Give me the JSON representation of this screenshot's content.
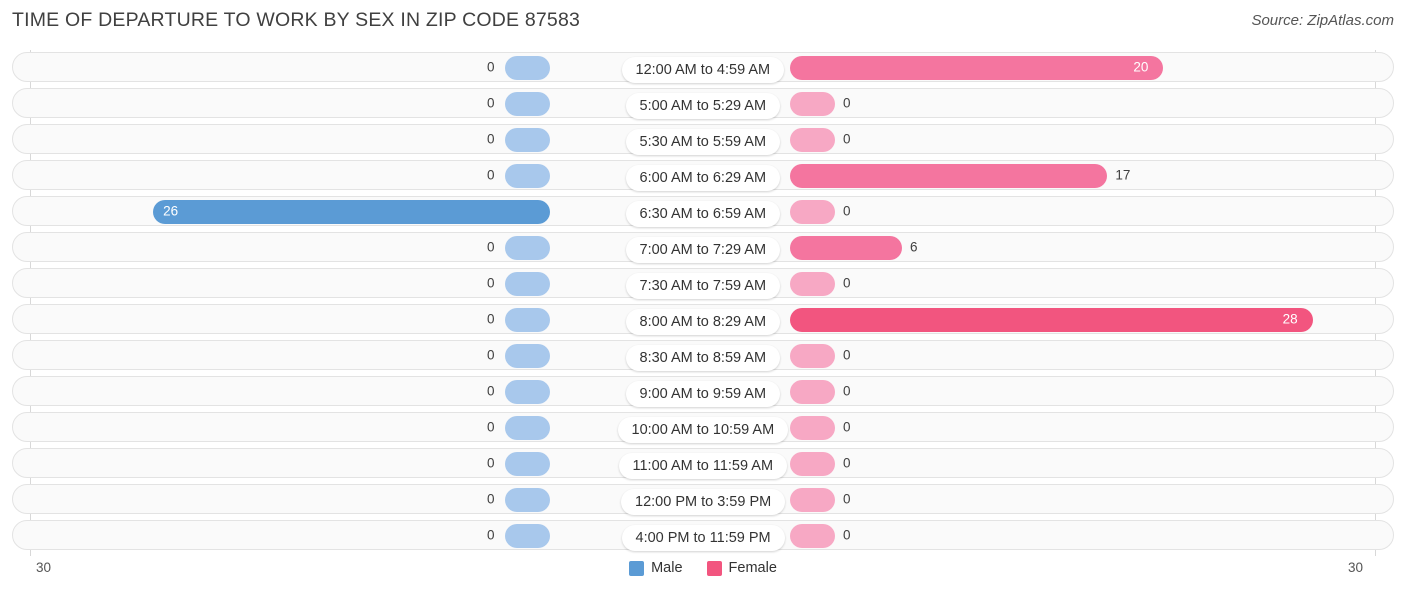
{
  "header": {
    "title": "TIME OF DEPARTURE TO WORK BY SEX IN ZIP CODE 87583",
    "source": "Source: ZipAtlas.com"
  },
  "legend": {
    "male_label": "Male",
    "female_label": "Female",
    "male_color": "#5b9bd5",
    "female_color": "#f2557f"
  },
  "axis": {
    "left_tick": "30",
    "right_tick": "30"
  },
  "chart_data": {
    "type": "bar",
    "orientation": "horizontal-diverging",
    "title": "TIME OF DEPARTURE TO WORK BY SEX IN ZIP CODE 87583",
    "xlabel": "",
    "ylabel": "",
    "xlim": [
      30,
      30
    ],
    "grid": false,
    "legend_position": "bottom-center",
    "categories": [
      "12:00 AM to 4:59 AM",
      "5:00 AM to 5:29 AM",
      "5:30 AM to 5:59 AM",
      "6:00 AM to 6:29 AM",
      "6:30 AM to 6:59 AM",
      "7:00 AM to 7:29 AM",
      "7:30 AM to 7:59 AM",
      "8:00 AM to 8:29 AM",
      "8:30 AM to 8:59 AM",
      "9:00 AM to 9:59 AM",
      "10:00 AM to 10:59 AM",
      "11:00 AM to 11:59 AM",
      "12:00 PM to 3:59 PM",
      "4:00 PM to 11:59 PM"
    ],
    "series": [
      {
        "name": "Male",
        "color": "#5b9bd5",
        "values": [
          0,
          0,
          0,
          0,
          26,
          0,
          0,
          0,
          0,
          0,
          0,
          0,
          0,
          0
        ]
      },
      {
        "name": "Female",
        "color": "#f2557f",
        "values": [
          20,
          0,
          0,
          17,
          0,
          6,
          0,
          28,
          0,
          0,
          0,
          0,
          0,
          0
        ]
      }
    ]
  }
}
